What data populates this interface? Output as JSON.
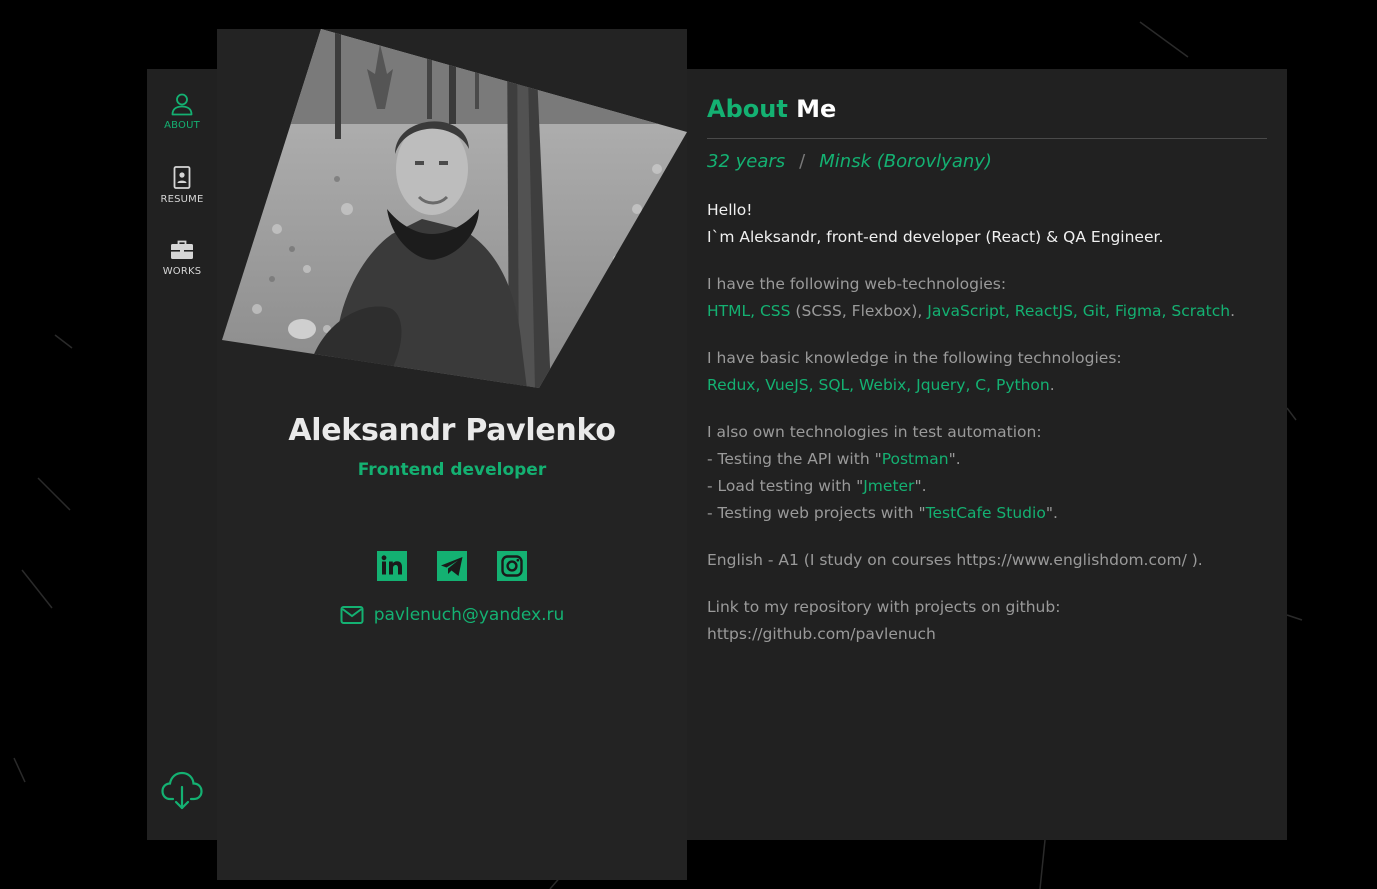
{
  "nav": {
    "items": [
      {
        "label": "ABOUT",
        "icon": "user-icon",
        "active": true
      },
      {
        "label": "RESUME",
        "icon": "id-card-icon",
        "active": false
      },
      {
        "label": "WORKS",
        "icon": "briefcase-icon",
        "active": false
      }
    ],
    "download_icon": "cloud-download-icon"
  },
  "profile": {
    "name": "Aleksandr Pavlenko",
    "role": "Frontend developer",
    "socials": [
      "linkedin-icon",
      "telegram-icon",
      "instagram-icon"
    ],
    "email": "pavlenuch@yandex.ru"
  },
  "about": {
    "title_accent": "About",
    "title_rest": " Me",
    "age": "32 years",
    "separator": "/",
    "location": "Minsk (Borovlyany)",
    "greeting_1": "Hello!",
    "greeting_2": "I`m Aleksandr, front-end developer (React) & QA Engineer.",
    "tech_intro": "I have the following web-technologies:",
    "tech_a": "HTML, CSS",
    "tech_b": " (SCSS, Flexbox), ",
    "tech_c": "JavaScript, ReactJS, Git, Figma, Scratch",
    "tech_d": ".",
    "basic_intro": "I have basic knowledge in the following technologies:",
    "basic_list": "Redux, VueJS, SQL, Webix, Jquery, C, Python",
    "basic_end": ".",
    "auto_intro": "I also own technologies in test automation:",
    "auto_1_pre": "- Testing the API with \"",
    "auto_1_tool": "Postman",
    "auto_1_post": "\".",
    "auto_2_pre": "- Load testing with \"",
    "auto_2_tool": "Jmeter",
    "auto_2_post": "\".",
    "auto_3_pre": "- Testing web projects with \"",
    "auto_3_tool": "TestCafe Studio",
    "auto_3_post": "\".",
    "english": "English - A1 (I study on courses https://www.englishdom.com/ ).",
    "repo_intro": "Link to my repository with projects on github:",
    "repo_url": "https://github.com/pavlenuch"
  },
  "colors": {
    "accent": "#14b172",
    "panel": "#212121",
    "background": "#000000"
  }
}
